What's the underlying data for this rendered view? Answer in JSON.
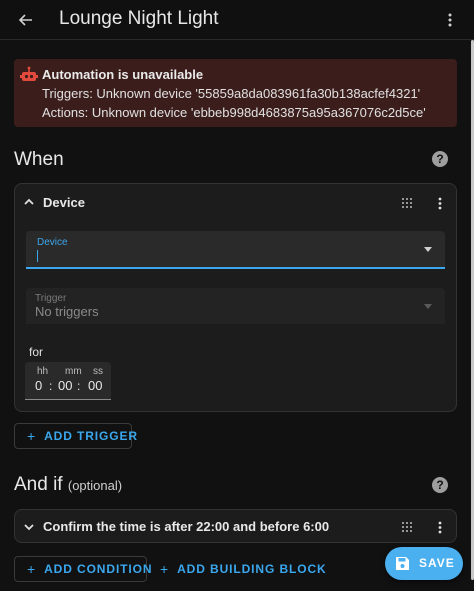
{
  "app": {
    "title": "Lounge Night Light"
  },
  "alert": {
    "title": "Automation is unavailable",
    "lines": [
      "Triggers: Unknown device '55859a8da083961fa30b138acfef4321'",
      "Actions: Unknown device 'ebbeb998d4683875a95a367076c2d5ce'"
    ]
  },
  "when": {
    "title": "When",
    "trigger_card": {
      "header": "Device",
      "device_field": {
        "label": "Device",
        "value": ""
      },
      "trigger_field": {
        "label": "Trigger",
        "value": "No triggers"
      },
      "for_label": "for",
      "duration": {
        "hh_label": "hh",
        "mm_label": "mm",
        "ss_label": "ss",
        "hh": "0",
        "mm": "00",
        "ss": "00",
        "sep": ":"
      }
    },
    "add_trigger_label": "ADD TRIGGER"
  },
  "and_if": {
    "title": "And if",
    "optional": "(optional)",
    "condition_card": {
      "header": "Confirm the time is after 22:00 and before 6:00"
    },
    "add_condition_label": "ADD CONDITION",
    "add_building_block_label": "ADD BUILDING BLOCK"
  },
  "fab": {
    "save_label": "SAVE"
  },
  "icons": {
    "back": "arrow-left-icon",
    "menu": "dots-vertical-icon",
    "alert": "robot-off-icon",
    "help": "help-circle-icon",
    "collapse": "chevron-up-icon",
    "expand": "chevron-down-icon",
    "drag": "drag-handle-icon",
    "add": "plus-icon",
    "save": "floppy-disk-icon"
  },
  "colors": {
    "accent": "#3ba7ee",
    "fab": "#4bb0ef",
    "alert_bg": "#3b1e1c",
    "alert_icon": "#e24a3d",
    "background": "#111111",
    "card": "#1c1c1c"
  }
}
